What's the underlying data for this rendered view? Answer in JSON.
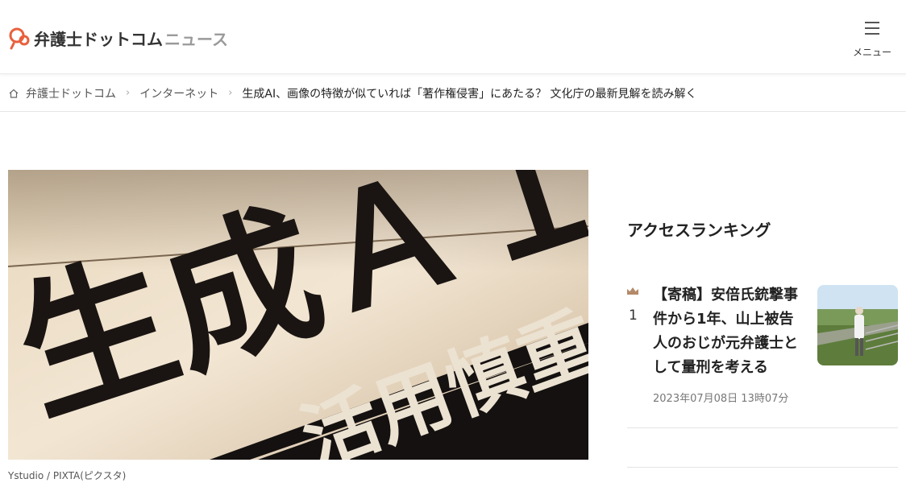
{
  "header": {
    "logo_main": "弁護士ドットコム",
    "logo_news": "ニュース",
    "menu_label": "メニュー",
    "brand_color": "#e8603c"
  },
  "breadcrumb": {
    "items": [
      "弁護士ドットコム",
      "インターネット"
    ],
    "current": "生成AI、画像の特徴が似ていれば「著作権侵害」にあたる？ 文化庁の最新見解を読み解く"
  },
  "hero": {
    "image_text_big": "生成ＡＩ",
    "image_text_band": "活用慎重",
    "credit": "Ystudio / PIXTA(ピクスタ)"
  },
  "ranking": {
    "title": "アクセスランキング",
    "items": [
      {
        "rank": "1",
        "headline": "【寄稿】安倍氏銃撃事件から1年、山上被告人のおじが元弁護士として量刑を考える",
        "date": "2023年07月08日 13時07分",
        "icon": "crown-icon"
      }
    ]
  }
}
